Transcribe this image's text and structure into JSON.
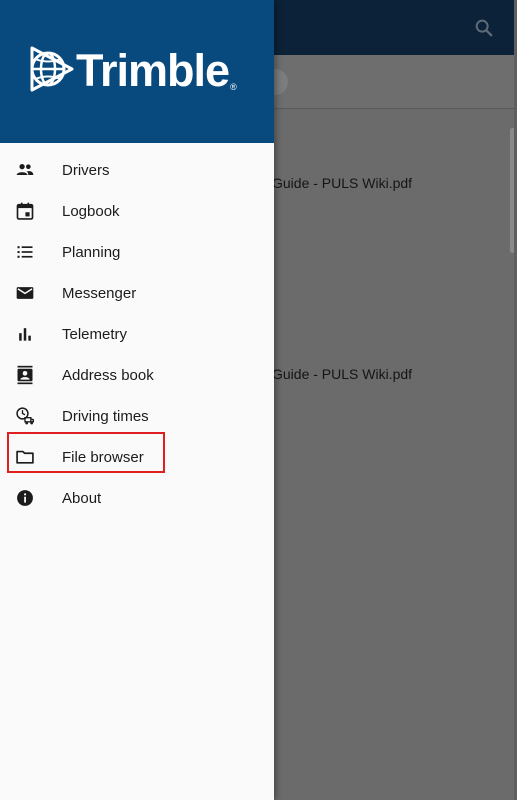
{
  "brand": {
    "name": "Trimble",
    "reg_mark": "®"
  },
  "background": {
    "files": [
      "Guide - PULS Wiki.pdf",
      "Guide - PULS Wiki.pdf"
    ]
  },
  "menu": {
    "items": [
      {
        "label": "Drivers",
        "icon": "people-icon"
      },
      {
        "label": "Logbook",
        "icon": "calendar-icon"
      },
      {
        "label": "Planning",
        "icon": "list-icon"
      },
      {
        "label": "Messenger",
        "icon": "mail-icon"
      },
      {
        "label": "Telemetry",
        "icon": "bar-chart-icon"
      },
      {
        "label": "Address book",
        "icon": "contacts-icon"
      },
      {
        "label": "Driving times",
        "icon": "truck-clock-icon"
      },
      {
        "label": "File browser",
        "icon": "folder-icon",
        "highlighted": true
      },
      {
        "label": "About",
        "icon": "info-icon"
      }
    ]
  },
  "colors": {
    "header": "#084a7e",
    "app_bar": "#0b2238",
    "highlight": "#e02020"
  }
}
